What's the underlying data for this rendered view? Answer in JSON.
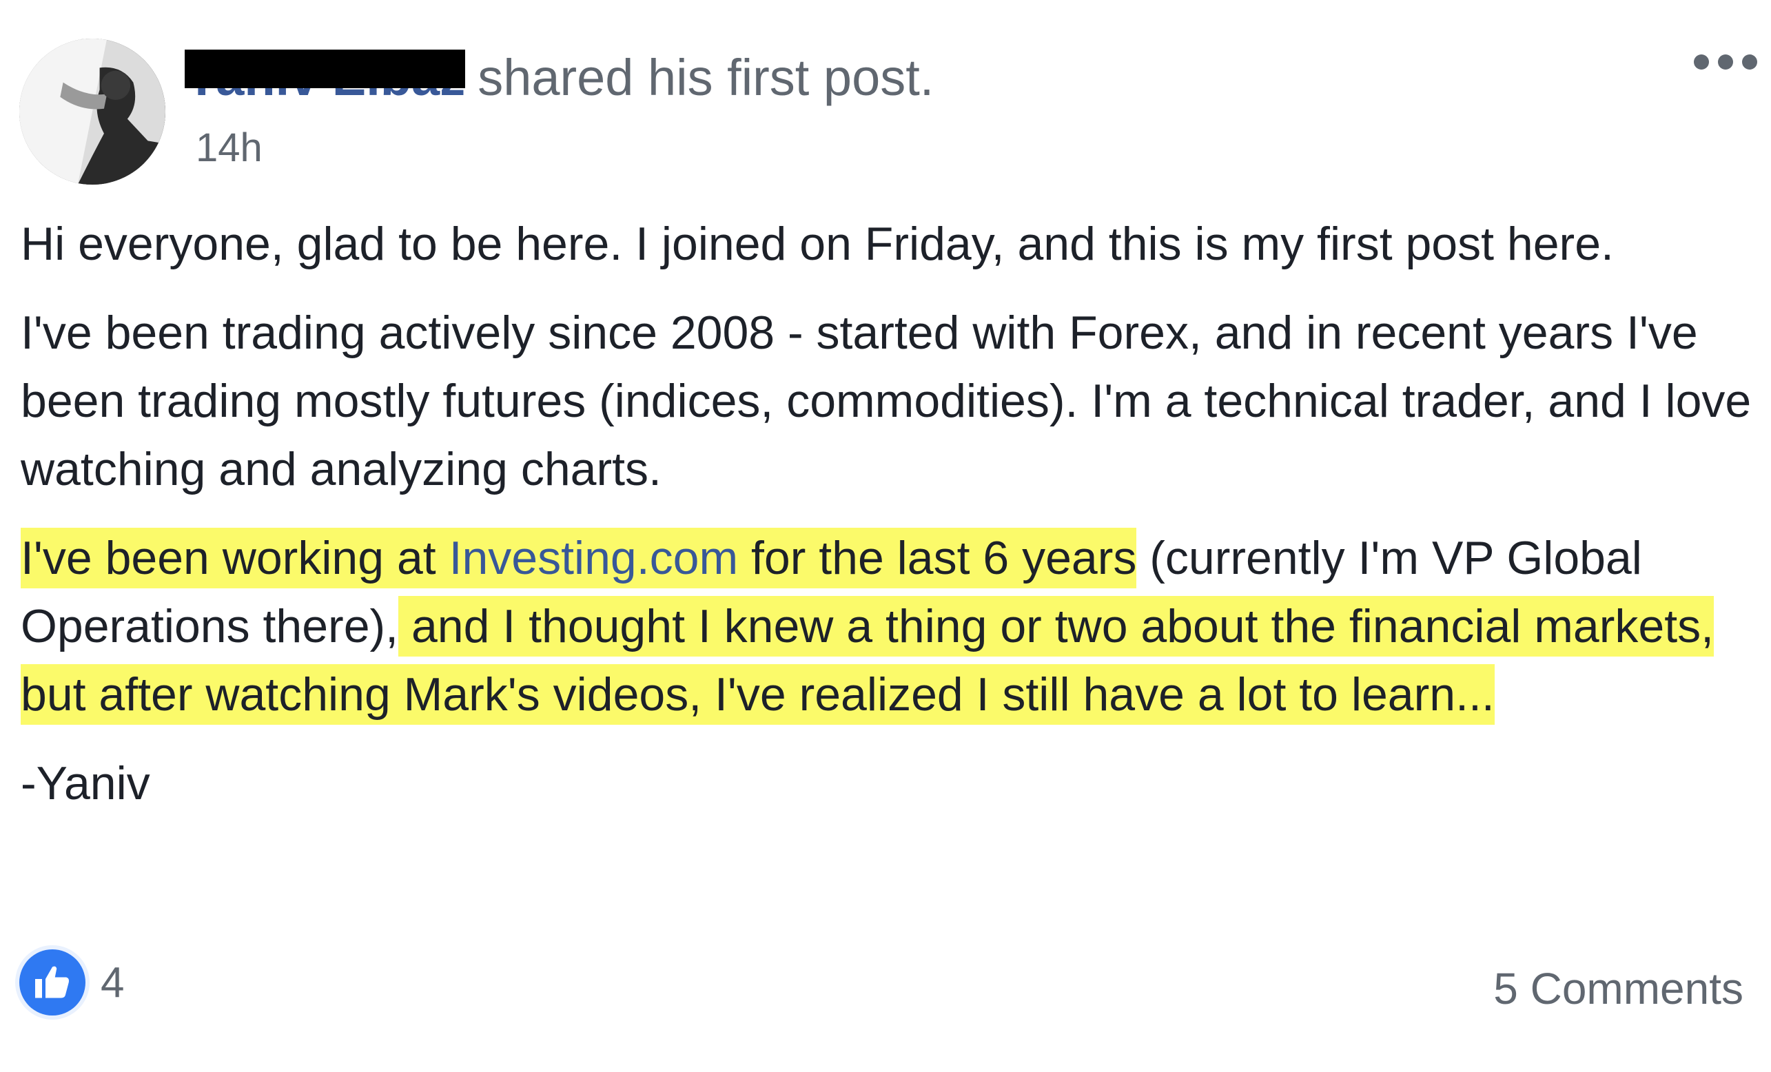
{
  "post": {
    "author_name": "Yaniv Elbaz",
    "action": "shared his first post.",
    "timestamp": "14h",
    "paragraphs": {
      "p1": "Hi everyone, glad to be here. I joined on Friday, and this is my first post here.",
      "p2": "I've been trading actively since 2008 - started with Forex, and in recent years I've been trading mostly futures (indices, commodities). I'm a technical trader, and I love watching and analyzing charts.",
      "p3a": "I've been working at ",
      "p3_link": "Investing.com",
      "p3b": " for the last 6 years",
      "p3c": " (currently I'm VP Global Operations there),",
      "p3d": " and I thought I knew a thing or two about the financial markets, but after watching Mark's videos, I've realized I still have a lot to learn... ",
      "signature": "-Yaniv"
    },
    "likes_count": "4",
    "comments_label": "5 Comments"
  },
  "icons": {
    "more": "more-options-icon",
    "like": "thumbs-up-icon"
  },
  "colors": {
    "highlight": "#fbfa6a",
    "link": "#385898",
    "like_badge": "#2f79f2",
    "secondary_text": "#606770"
  }
}
